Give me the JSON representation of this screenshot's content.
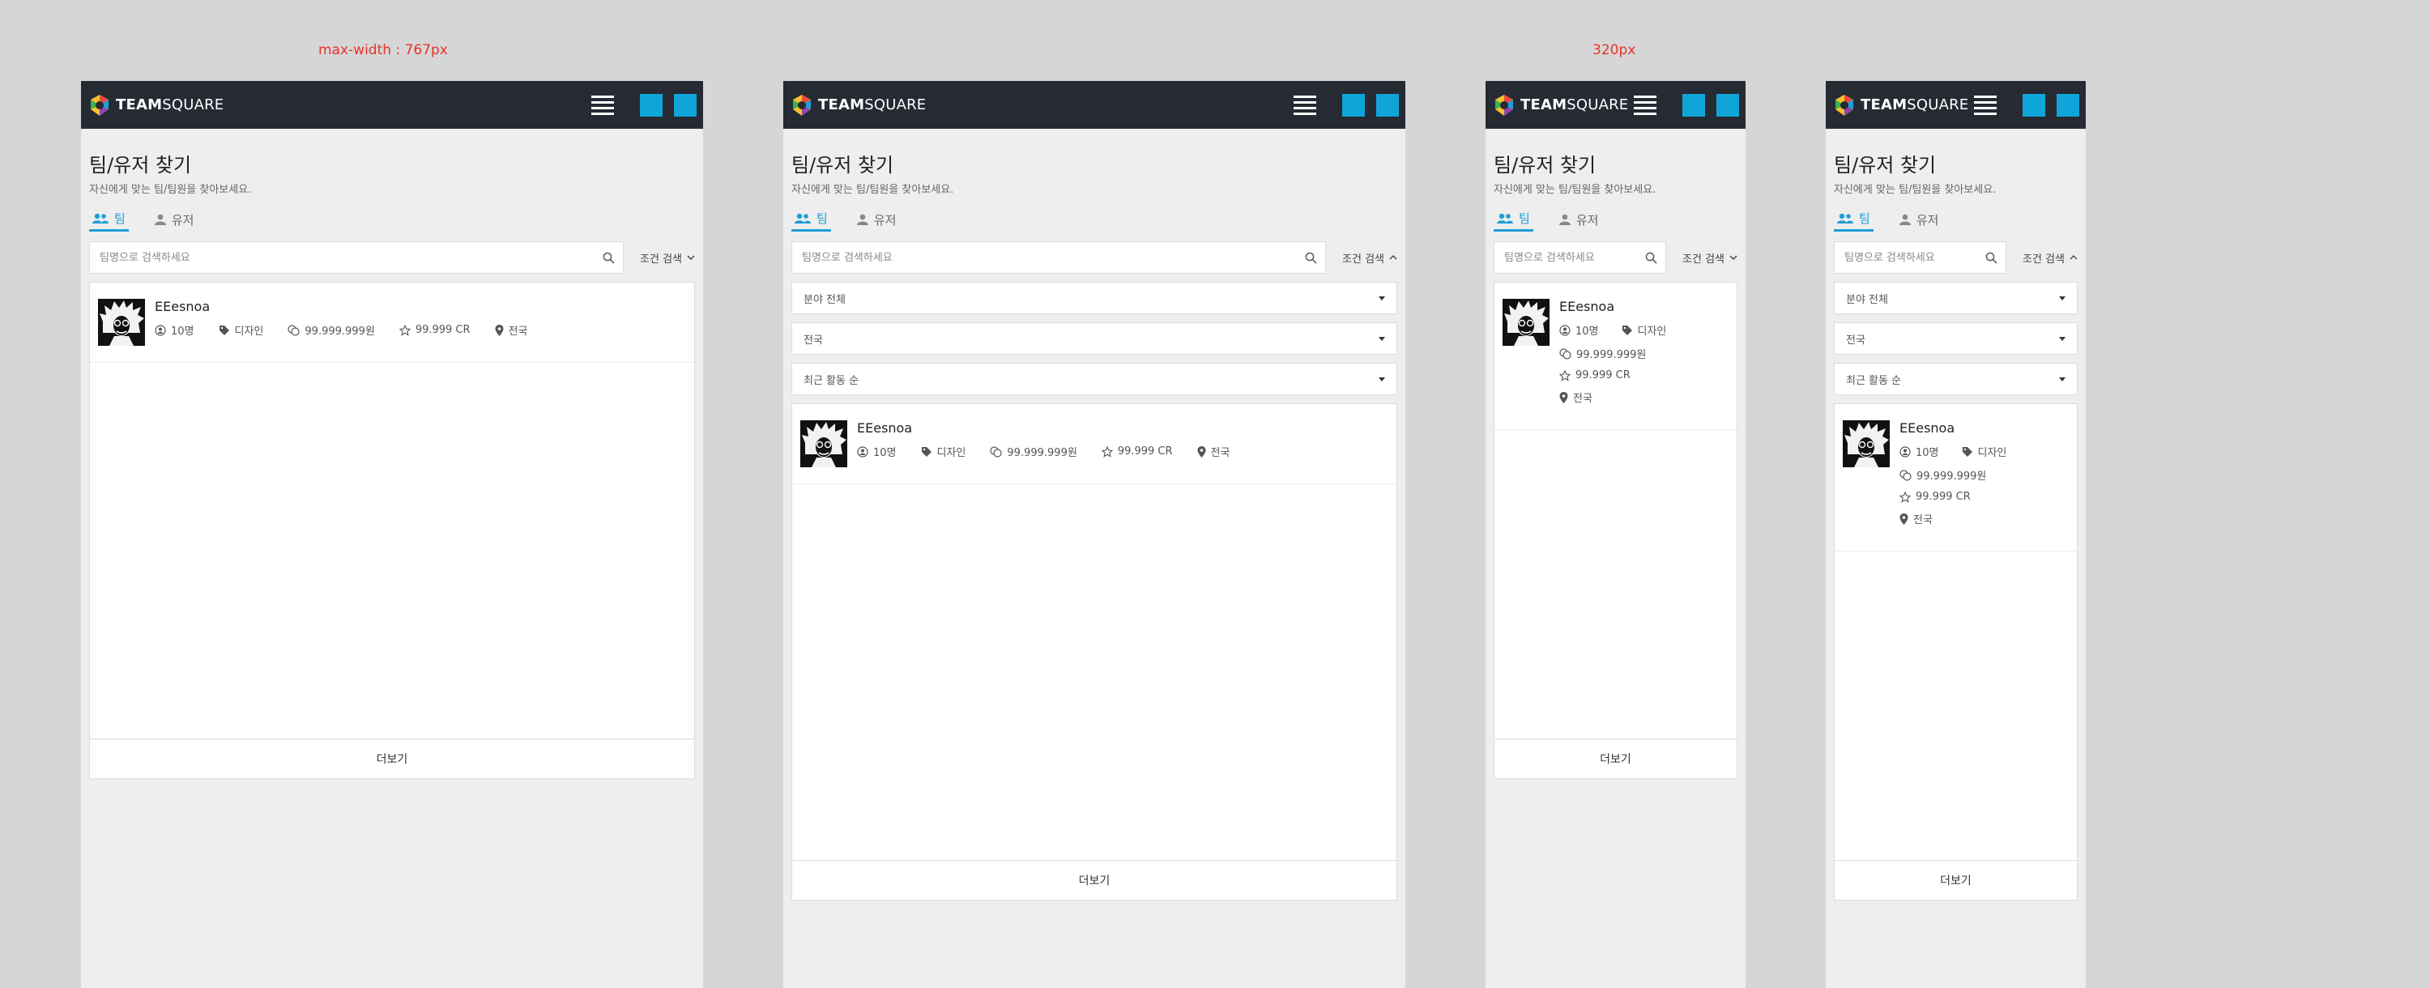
{
  "annotations": {
    "breakpoint_max": "max-width : 767px",
    "breakpoint_min": "320px"
  },
  "app": {
    "logo_bold": "TEAM",
    "logo_rest": "SQUARE",
    "logo_colors": [
      "#e94b3c",
      "#f6c12d",
      "#3cb44b",
      "#1d9fd6",
      "#8e44ad"
    ],
    "accent_color": "#0fa5d8"
  },
  "page": {
    "title": "팀/유저 찾기",
    "subtitle": "자신에게 맞는 팀/팀원을 찾아보세요."
  },
  "tabs": [
    {
      "label": "팀",
      "icon": "users-icon",
      "active": true
    },
    {
      "label": "유저",
      "icon": "user-icon",
      "active": false
    }
  ],
  "search": {
    "placeholder": "팀명으로 검색하세요",
    "filter_label": "조건 검색"
  },
  "filters": {
    "field": "분야 전체",
    "region": "전국",
    "sort": "최근 활동 순"
  },
  "result": {
    "name": "EEesnoa",
    "members": "10명",
    "category": "디자인",
    "price": "99.999.999원",
    "credit": "99.999 CR",
    "location": "전국"
  },
  "more_label": "더보기"
}
